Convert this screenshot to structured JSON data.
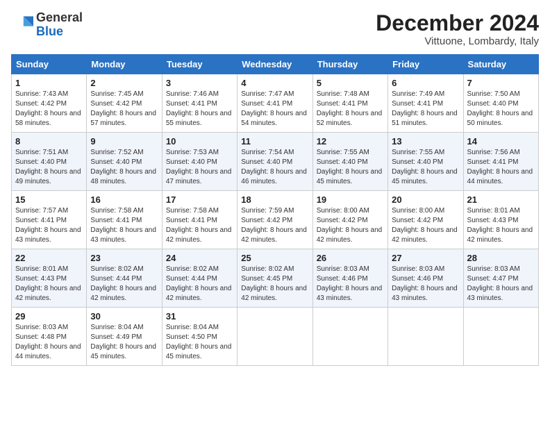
{
  "logo": {
    "general": "General",
    "blue": "Blue"
  },
  "header": {
    "month": "December 2024",
    "location": "Vittuone, Lombardy, Italy"
  },
  "weekdays": [
    "Sunday",
    "Monday",
    "Tuesday",
    "Wednesday",
    "Thursday",
    "Friday",
    "Saturday"
  ],
  "weeks": [
    [
      {
        "day": "1",
        "sunrise": "7:43 AM",
        "sunset": "4:42 PM",
        "daylight": "8 hours and 58 minutes."
      },
      {
        "day": "2",
        "sunrise": "7:45 AM",
        "sunset": "4:42 PM",
        "daylight": "8 hours and 57 minutes."
      },
      {
        "day": "3",
        "sunrise": "7:46 AM",
        "sunset": "4:41 PM",
        "daylight": "8 hours and 55 minutes."
      },
      {
        "day": "4",
        "sunrise": "7:47 AM",
        "sunset": "4:41 PM",
        "daylight": "8 hours and 54 minutes."
      },
      {
        "day": "5",
        "sunrise": "7:48 AM",
        "sunset": "4:41 PM",
        "daylight": "8 hours and 52 minutes."
      },
      {
        "day": "6",
        "sunrise": "7:49 AM",
        "sunset": "4:41 PM",
        "daylight": "8 hours and 51 minutes."
      },
      {
        "day": "7",
        "sunrise": "7:50 AM",
        "sunset": "4:40 PM",
        "daylight": "8 hours and 50 minutes."
      }
    ],
    [
      {
        "day": "8",
        "sunrise": "7:51 AM",
        "sunset": "4:40 PM",
        "daylight": "8 hours and 49 minutes."
      },
      {
        "day": "9",
        "sunrise": "7:52 AM",
        "sunset": "4:40 PM",
        "daylight": "8 hours and 48 minutes."
      },
      {
        "day": "10",
        "sunrise": "7:53 AM",
        "sunset": "4:40 PM",
        "daylight": "8 hours and 47 minutes."
      },
      {
        "day": "11",
        "sunrise": "7:54 AM",
        "sunset": "4:40 PM",
        "daylight": "8 hours and 46 minutes."
      },
      {
        "day": "12",
        "sunrise": "7:55 AM",
        "sunset": "4:40 PM",
        "daylight": "8 hours and 45 minutes."
      },
      {
        "day": "13",
        "sunrise": "7:55 AM",
        "sunset": "4:40 PM",
        "daylight": "8 hours and 45 minutes."
      },
      {
        "day": "14",
        "sunrise": "7:56 AM",
        "sunset": "4:41 PM",
        "daylight": "8 hours and 44 minutes."
      }
    ],
    [
      {
        "day": "15",
        "sunrise": "7:57 AM",
        "sunset": "4:41 PM",
        "daylight": "8 hours and 43 minutes."
      },
      {
        "day": "16",
        "sunrise": "7:58 AM",
        "sunset": "4:41 PM",
        "daylight": "8 hours and 43 minutes."
      },
      {
        "day": "17",
        "sunrise": "7:58 AM",
        "sunset": "4:41 PM",
        "daylight": "8 hours and 42 minutes."
      },
      {
        "day": "18",
        "sunrise": "7:59 AM",
        "sunset": "4:42 PM",
        "daylight": "8 hours and 42 minutes."
      },
      {
        "day": "19",
        "sunrise": "8:00 AM",
        "sunset": "4:42 PM",
        "daylight": "8 hours and 42 minutes."
      },
      {
        "day": "20",
        "sunrise": "8:00 AM",
        "sunset": "4:42 PM",
        "daylight": "8 hours and 42 minutes."
      },
      {
        "day": "21",
        "sunrise": "8:01 AM",
        "sunset": "4:43 PM",
        "daylight": "8 hours and 42 minutes."
      }
    ],
    [
      {
        "day": "22",
        "sunrise": "8:01 AM",
        "sunset": "4:43 PM",
        "daylight": "8 hours and 42 minutes."
      },
      {
        "day": "23",
        "sunrise": "8:02 AM",
        "sunset": "4:44 PM",
        "daylight": "8 hours and 42 minutes."
      },
      {
        "day": "24",
        "sunrise": "8:02 AM",
        "sunset": "4:44 PM",
        "daylight": "8 hours and 42 minutes."
      },
      {
        "day": "25",
        "sunrise": "8:02 AM",
        "sunset": "4:45 PM",
        "daylight": "8 hours and 42 minutes."
      },
      {
        "day": "26",
        "sunrise": "8:03 AM",
        "sunset": "4:46 PM",
        "daylight": "8 hours and 43 minutes."
      },
      {
        "day": "27",
        "sunrise": "8:03 AM",
        "sunset": "4:46 PM",
        "daylight": "8 hours and 43 minutes."
      },
      {
        "day": "28",
        "sunrise": "8:03 AM",
        "sunset": "4:47 PM",
        "daylight": "8 hours and 43 minutes."
      }
    ],
    [
      {
        "day": "29",
        "sunrise": "8:03 AM",
        "sunset": "4:48 PM",
        "daylight": "8 hours and 44 minutes."
      },
      {
        "day": "30",
        "sunrise": "8:04 AM",
        "sunset": "4:49 PM",
        "daylight": "8 hours and 45 minutes."
      },
      {
        "day": "31",
        "sunrise": "8:04 AM",
        "sunset": "4:50 PM",
        "daylight": "8 hours and 45 minutes."
      },
      null,
      null,
      null,
      null
    ]
  ],
  "labels": {
    "sunrise": "Sunrise:",
    "sunset": "Sunset:",
    "daylight": "Daylight:"
  }
}
